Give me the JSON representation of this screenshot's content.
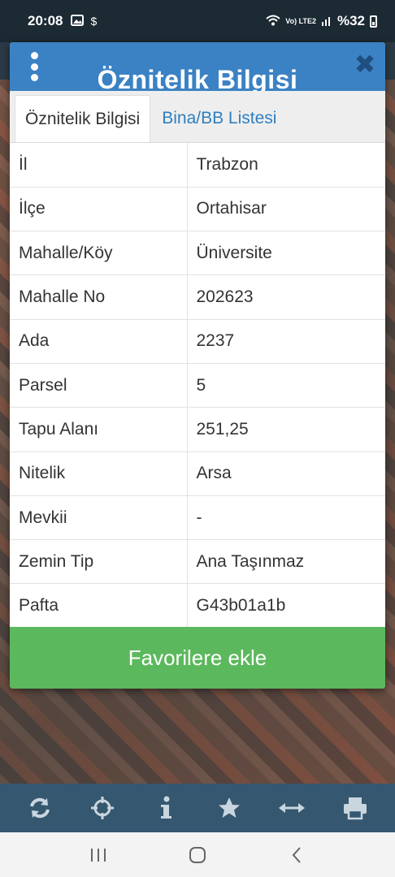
{
  "status_bar": {
    "time": "20:08",
    "network": "Vo) LTE2",
    "battery": "%32"
  },
  "dialog": {
    "title": "Öznitelik Bilgisi",
    "tabs": [
      {
        "label": "Öznitelik Bilgisi",
        "active": true
      },
      {
        "label": "Bina/BB Listesi",
        "active": false
      }
    ],
    "rows": [
      {
        "key": "İl",
        "value": "Trabzon"
      },
      {
        "key": "İlçe",
        "value": "Ortahisar"
      },
      {
        "key": "Mahalle/Köy",
        "value": "Üniversite"
      },
      {
        "key": "Mahalle No",
        "value": "202623"
      },
      {
        "key": "Ada",
        "value": "2237"
      },
      {
        "key": "Parsel",
        "value": "5"
      },
      {
        "key": "Tapu Alanı",
        "value": "251,25"
      },
      {
        "key": "Nitelik",
        "value": "Arsa"
      },
      {
        "key": "Mevkii",
        "value": "-"
      },
      {
        "key": "Zemin Tip",
        "value": "Ana Taşınmaz"
      },
      {
        "key": "Pafta",
        "value": "G43b01a1b"
      }
    ],
    "favorite_button": "Favorilere ekle"
  },
  "toolbar": {
    "icons": [
      "refresh-icon",
      "crosshair-icon",
      "info-icon",
      "star-icon",
      "measure-icon",
      "print-icon"
    ]
  },
  "navbar": {
    "icons": [
      "recent-apps-icon",
      "home-icon",
      "back-icon"
    ]
  },
  "colors": {
    "header_blue": "#3b82c4",
    "tab_link": "#2f7fc0",
    "favorite_green": "#5cb85c",
    "toolbar_bg": "#35576f"
  }
}
